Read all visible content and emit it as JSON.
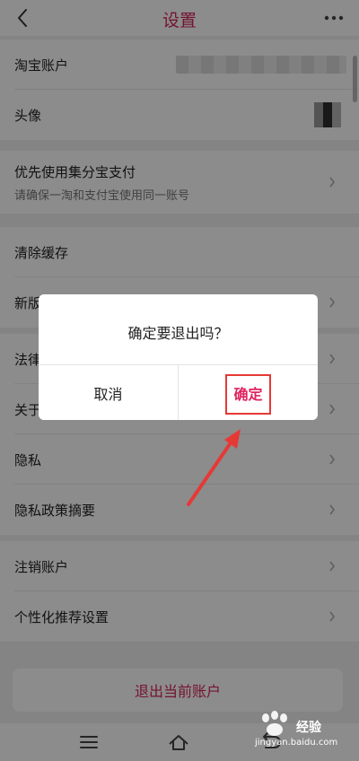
{
  "header": {
    "title": "设置"
  },
  "settings": {
    "account_label": "淘宝账户",
    "avatar_label": "头像",
    "jifen": {
      "label": "优先使用集分宝支付",
      "sub": "请确保一淘和支付宝使用同一账号"
    },
    "clear_cache": "清除缓存",
    "new_version": "新版",
    "legal": "法律",
    "about": "关于",
    "privacy": "隐私",
    "privacy_summary": "隐私政策摘要",
    "cancel_account": "注销账户",
    "personalized": "个性化推荐设置"
  },
  "logout_label": "退出当前账户",
  "dialog": {
    "message": "确定要退出吗？",
    "cancel_label": "取消",
    "confirm_label": "确定"
  },
  "watermark": {
    "text": "经验",
    "url": "jingyan.baidu.com"
  },
  "colors": {
    "accent": "#d6235a",
    "highlight": "#e53935"
  }
}
